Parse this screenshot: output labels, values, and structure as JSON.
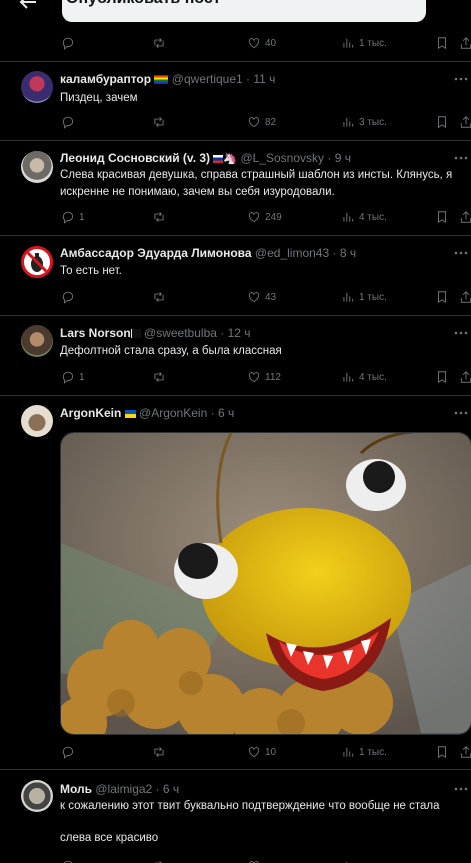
{
  "header": {
    "publish_label": "Опубликовать пост"
  },
  "first_actions": {
    "replies": "",
    "retweets": "",
    "likes": "40",
    "views": "1 тыс."
  },
  "tweets": [
    {
      "name": "каламбураптор",
      "handle": "@qwertique1",
      "time": "· 11 ч",
      "text": "Пиздец, зачем",
      "replies": "",
      "retweets": "",
      "likes": "82",
      "views": "3 тыс."
    },
    {
      "name": "Леонид Сосновский (v. 3)",
      "handle": "@L_Sosnovsky",
      "time": "· 9 ч",
      "text": "Слева красивая девушка, справа страшный шаблон из инсты. Клянусь, я искренне не понимаю, зачем вы себя изуродовали.",
      "replies": "1",
      "retweets": "",
      "likes": "249",
      "views": "4 тыс."
    },
    {
      "name": "Амбассадор Эдуарда Лимонова",
      "handle": "@ed_limon43",
      "time": "· 8 ч",
      "text": "То есть нет.",
      "replies": "",
      "retweets": "",
      "likes": "43",
      "views": "1 тыс."
    },
    {
      "name": "Lars Norson",
      "handle": "@sweetbulba",
      "time": "· 12 ч",
      "text": "Дефолтной стала сразу, а была классная",
      "replies": "1",
      "retweets": "",
      "likes": "112",
      "views": "4 тыс."
    },
    {
      "name": "ArgonKein",
      "handle": "@ArgonKein",
      "time": "· 6 ч",
      "text": "",
      "replies": "",
      "retweets": "",
      "likes": "10",
      "views": "1 тыс."
    },
    {
      "name": "Моль",
      "handle": "@laimiga2",
      "time": "· 6 ч",
      "text": "к сожалению этот твит буквально подтверждение что вообще не стала",
      "text2": "слева все красиво",
      "replies": "",
      "retweets": "",
      "likes": "",
      "views": ""
    }
  ],
  "colors": {
    "background": "#000000",
    "text": "#e7e9ea",
    "muted": "#71767b",
    "divider": "#2f3336"
  },
  "icons": [
    "back-arrow-icon",
    "reply-icon",
    "retweet-icon",
    "like-icon",
    "views-icon",
    "bookmark-icon",
    "share-icon",
    "more-icon"
  ]
}
